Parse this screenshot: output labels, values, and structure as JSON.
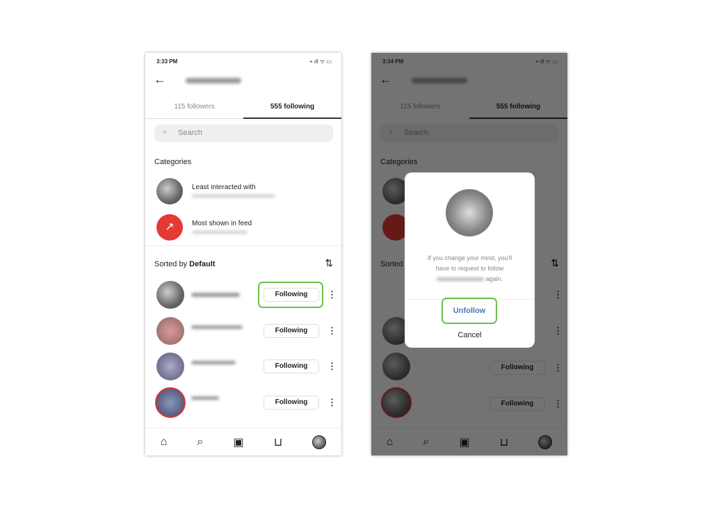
{
  "left_phone": {
    "time": "3:33 PM"
  },
  "right_phone": {
    "time": "3:34 PM"
  },
  "common": {
    "followers": "115 followers",
    "following": "555 following",
    "search_placeholder": "Search",
    "categories": "Categories",
    "cat1": "Least interacted with",
    "cat2": "Most shown in feed",
    "sorted_by": "Sorted by ",
    "sort_value": "Default",
    "following_btn": "Following",
    "status_icons": "⌖ ıll ᯤ ▭"
  },
  "dialog": {
    "line1": "If you change your mind, you'll",
    "line2": "have to request to follow",
    "line3": "again.",
    "unfollow": "Unfollow",
    "cancel": "Cancel"
  },
  "colors": {
    "highlight": "#6cc04a",
    "unfollow": "#4a74b8"
  }
}
